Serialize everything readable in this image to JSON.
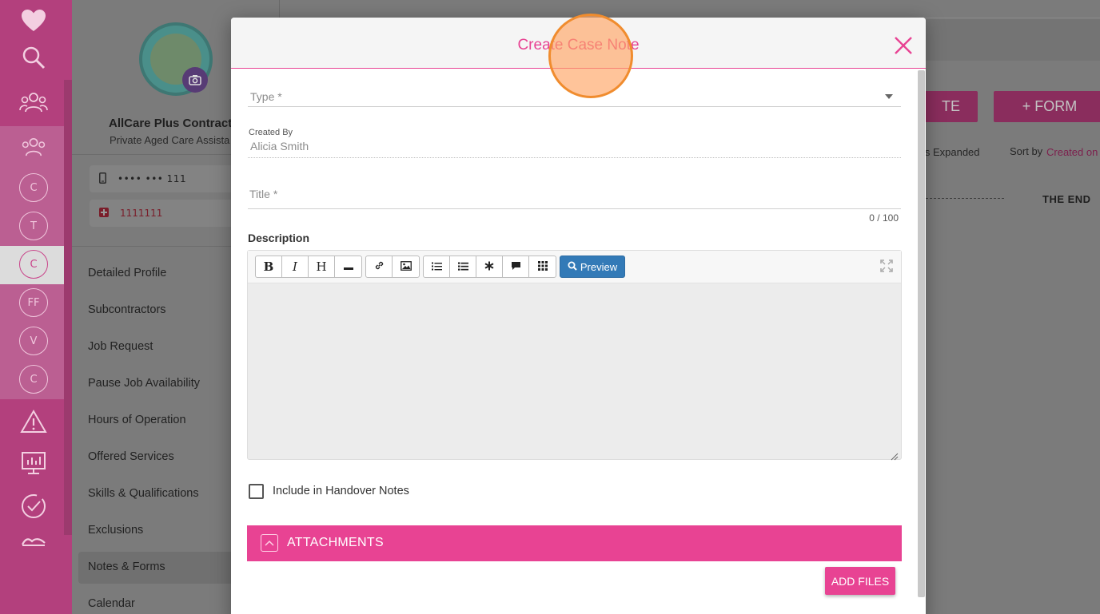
{
  "colors": {
    "accent": "#e84393",
    "rail": "#c9448a",
    "preview_button": "#337ab7",
    "overlay_dim": "#7b7b7b",
    "click_marker": "#f08c2e"
  },
  "rail": {
    "icons": [
      "heart-icon",
      "search-icon",
      "people-icon",
      "group-icon",
      "warning-icon",
      "monitor-chart-icon",
      "clock-check-icon",
      "handshake-icon"
    ],
    "circles": [
      "C",
      "T",
      "C",
      "FF",
      "V",
      "C"
    ],
    "selected_circle_index": 2
  },
  "profile": {
    "name": "AllCare Plus Contracto",
    "subtitle": "Private Aged Care Assista",
    "phone": "•••• ••• 111",
    "emergency": "1111111"
  },
  "nav": {
    "items": [
      "Detailed Profile",
      "Subcontractors",
      "Job Request",
      "Pause Job Availability",
      "Hours of Operation",
      "Offered Services",
      "Skills & Qualifications",
      "Exclusions",
      "Notes & Forms",
      "Calendar"
    ],
    "active": "Notes & Forms"
  },
  "main": {
    "note_button": "TE",
    "form_button": "+ FORM",
    "expanded_text": "tes Expanded",
    "sort_label": "Sort by",
    "sort_value": "Created on",
    "end_text": "THE END"
  },
  "modal": {
    "title": "Create Case Note",
    "type_placeholder": "Type *",
    "created_by_label": "Created By",
    "created_by_value": "Alicia Smith",
    "title_placeholder": "Title *",
    "title_counter": "0 / 100",
    "description_label": "Description",
    "toolbar": {
      "bold": "B",
      "italic": "I",
      "heading": "H",
      "preview": "Preview",
      "icons": [
        "bold-icon",
        "italic-icon",
        "heading-icon",
        "horizontal-rule-icon",
        "link-icon",
        "image-icon",
        "unordered-list-icon",
        "ordered-list-icon",
        "asterisk-icon",
        "quote-icon",
        "table-icon",
        "preview-search-icon",
        "fullscreen-icon"
      ]
    },
    "handover_label": "Include in Handover Notes",
    "handover_checked": false,
    "attachments_label": "ATTACHMENTS",
    "add_files_label": "ADD FILES"
  }
}
